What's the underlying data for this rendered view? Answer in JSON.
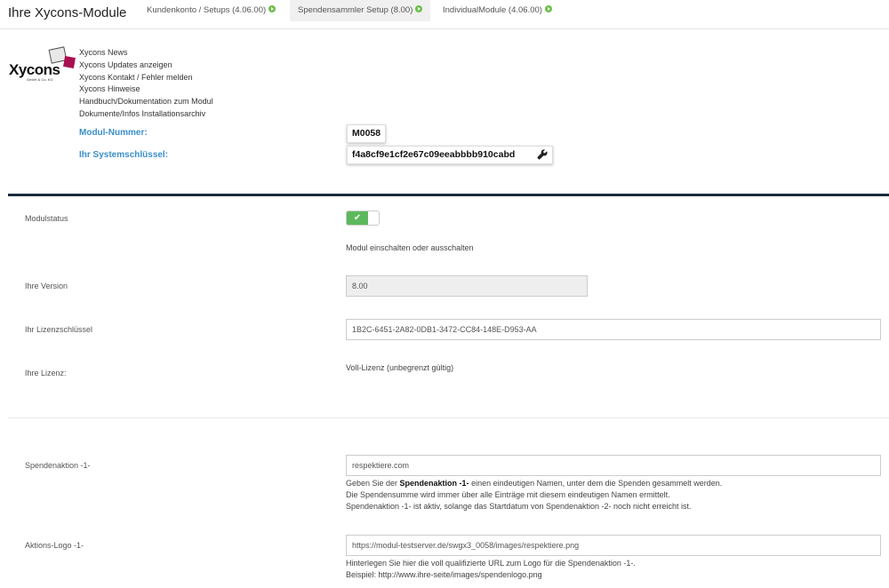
{
  "header": {
    "title": "Ihre Xycons-Module",
    "tabs": [
      {
        "label": "Kundenkonto / Setups (4.06.00)",
        "active": false
      },
      {
        "label": "Spendensammler Setup (8.00)",
        "active": true
      },
      {
        "label": "IndividualModule (4.06.00)",
        "active": false
      }
    ]
  },
  "logo": {
    "word": "Xycons",
    "sub": "GmbH & Co. KG"
  },
  "links": [
    "Xycons News",
    "Xycons Updates anzeigen",
    "Xycons Kontakt / Fehler melden",
    "Xycons Hinweise",
    "Handbuch/Dokumentation zum Modul",
    "Dokumente/Infos Installationsarchiv"
  ],
  "module": {
    "number_label": "Modul-Nummer:",
    "number_value": "M0058",
    "key_label": "Ihr Systemschlüssel:",
    "key_value": "f4a8cf9e1cf2e67c09eeabbbb910cabd"
  },
  "status": {
    "label": "Modulstatus",
    "enabled": true,
    "check": "✔",
    "hint": "Modul einschalten oder ausschalten"
  },
  "version": {
    "label": "Ihre Version",
    "value": "8.00"
  },
  "license_key": {
    "label": "Ihr Lizenzschlüssel",
    "value": "1B2C-6451-2A82-0DB1-3472-CC84-148E-D953-AA"
  },
  "license": {
    "label": "Ihre Lizenz:",
    "value": "Voll-Lizenz (unbegrenzt gültig)"
  },
  "action1": {
    "label": "Spendenaktion -1-",
    "value": "respektiere.com",
    "hint_pre": "Geben Sie der ",
    "hint_bold": "Spendenaktion -1-",
    "hint_post": " einen eindeutigen Namen, unter dem die Spenden gesammelt werden.",
    "hint_line2": "Die Spendensumme wird immer über alle Einträge mit diesem eindeutigen Namen ermittelt.",
    "hint_line3": "Spendenaktion -1- ist aktiv, solange das Startdatum von Spendenaktion -2- noch nicht erreicht ist."
  },
  "logo1": {
    "label": "Aktions-Logo -1-",
    "value": "https://modul-testserver.de/swgx3_0058/images/respektiere.png",
    "hint_line1": "Hinterlegen Sie hier die voll qualifizierte URL zum Logo für die Spendenaktion -1-.",
    "hint_line2": "Beispiel: http://www.ihre-seite/images/spendenlogo.png"
  },
  "colors": {
    "accent": "#3a8fc9",
    "toggle_on": "#5cb85c",
    "dark_line": "#1b2b3a"
  }
}
